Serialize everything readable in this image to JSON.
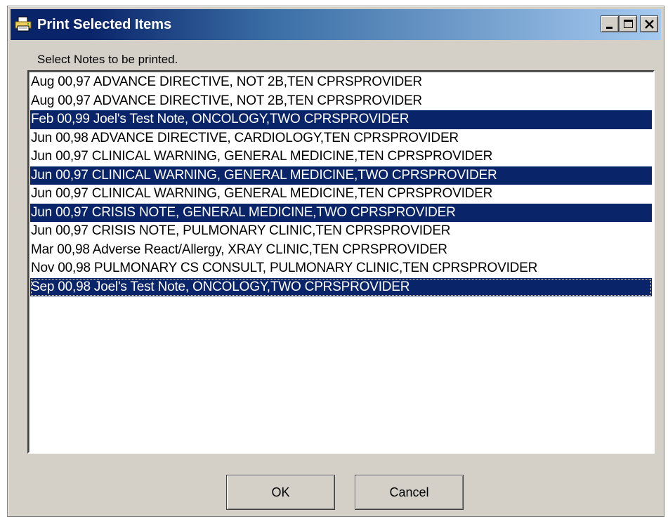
{
  "window": {
    "title": "Print Selected Items",
    "title_icon": "printer-icon",
    "controls": {
      "minimize_icon": "minimize-icon",
      "maximize_icon": "maximize-icon",
      "close_icon": "close-icon"
    }
  },
  "prompt": "Select Notes to be printed.",
  "notes": [
    {
      "text": "Aug 00,97  ADVANCE DIRECTIVE, NOT 2B,TEN CPRSPROVIDER",
      "selected": false
    },
    {
      "text": "Aug 00,97  ADVANCE DIRECTIVE, NOT 2B,TEN CPRSPROVIDER",
      "selected": false
    },
    {
      "text": "Feb 00,99  Joel's Test Note, ONCOLOGY,TWO CPRSPROVIDER",
      "selected": true
    },
    {
      "text": "Jun 00,98  ADVANCE DIRECTIVE, CARDIOLOGY,TEN CPRSPROVIDER",
      "selected": false
    },
    {
      "text": "Jun 00,97  CLINICAL WARNING, GENERAL MEDICINE,TEN CPRSPROVIDER",
      "selected": false
    },
    {
      "text": "Jun 00,97  CLINICAL WARNING, GENERAL MEDICINE,TWO CPRSPROVIDER",
      "selected": true
    },
    {
      "text": "Jun 00,97  CLINICAL WARNING, GENERAL MEDICINE,TEN CPRSPROVIDER",
      "selected": false
    },
    {
      "text": "Jun 00,97  CRISIS NOTE, GENERAL MEDICINE,TWO CPRSPROVIDER",
      "selected": true
    },
    {
      "text": "Jun 00,97  CRISIS NOTE, PULMONARY CLINIC,TEN CPRSPROVIDER",
      "selected": false
    },
    {
      "text": "Mar 00,98  Adverse React/Allergy, XRAY CLINIC,TEN CPRSPROVIDER",
      "selected": false
    },
    {
      "text": "Nov 00,98  PULMONARY CS CONSULT, PULMONARY CLINIC,TEN CPRSPROVIDER",
      "selected": false
    },
    {
      "text": "Sep 00,98  Joel's Test Note, ONCOLOGY,TWO CPRSPROVIDER",
      "selected": true,
      "focused": true
    }
  ],
  "buttons": {
    "ok_label": "OK",
    "cancel_label": "Cancel"
  },
  "colors": {
    "selection": "#0a246a",
    "window_face": "#d4d0c8",
    "title_gradient_start": "#0a246a",
    "title_gradient_end": "#a6caf0"
  }
}
